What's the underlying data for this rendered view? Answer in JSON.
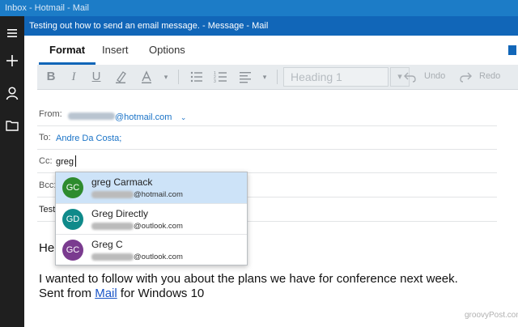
{
  "window": {
    "title": "Inbox - Hotmail - Mail"
  },
  "message_window": {
    "title": "Testing out how to send an email message. - Message - Mail"
  },
  "leftbar": {
    "icons": [
      "hamburger-menu-icon",
      "new-mail-plus-icon",
      "person-account-icon",
      "folder-icon"
    ]
  },
  "tabs": [
    {
      "label": "Format",
      "active": true
    },
    {
      "label": "Insert",
      "active": false
    },
    {
      "label": "Options",
      "active": false
    }
  ],
  "toolbar": {
    "bold": "B",
    "italic": "I",
    "underline": "U",
    "heading_value": "Heading 1",
    "undo": "Undo",
    "redo": "Redo"
  },
  "fields": {
    "from_label": "From:",
    "from_value": "@hotmail.com",
    "to_label": "To:",
    "to_value": "Andre Da Costa;",
    "cc_label": "Cc:",
    "cc_value": "greg",
    "bcc_label": "Bcc:",
    "subject_partial": "Testi"
  },
  "suggestions": [
    {
      "initials": "GC",
      "name": "greg Carmack",
      "email": "@hotmail.com",
      "color": "#2e8b2e",
      "selected": true
    },
    {
      "initials": "GD",
      "name": "Greg Directly",
      "email": "@outlook.com",
      "color": "#0f8a8a",
      "selected": false
    },
    {
      "initials": "GC",
      "name": "Greg C",
      "email": "@outlook.com",
      "color": "#7a3b8f",
      "selected": false
    }
  ],
  "body": {
    "greeting_partial": "He",
    "line1": "I wanted to follow with you about the plans we have for conference  next week.",
    "sent_prefix": "Sent from ",
    "sent_link": "Mail",
    "sent_suffix": " for Windows 10"
  },
  "watermark": "groovyPost.com",
  "colors": {
    "accent": "#1166b8",
    "titlebar": "#1c7cc7",
    "selected_suggestion": "#cde3f8"
  }
}
